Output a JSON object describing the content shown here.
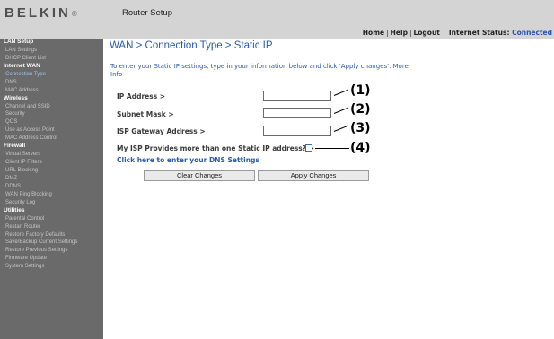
{
  "header": {
    "logo": "BELKIN",
    "logo_mark": "®",
    "title": "Router Setup",
    "nav": {
      "home": "Home",
      "help": "Help",
      "logout": "Logout",
      "separator": "|"
    },
    "status_label": "Internet Status:",
    "status_value": "Connected"
  },
  "sidebar": {
    "items": [
      {
        "label": "LAN Setup",
        "type": "header"
      },
      {
        "label": "LAN Settings",
        "type": "item"
      },
      {
        "label": "DHCP Client List",
        "type": "item"
      },
      {
        "label": "Internet WAN",
        "type": "header"
      },
      {
        "label": "Connection Type",
        "type": "active"
      },
      {
        "label": "DNS",
        "type": "item"
      },
      {
        "label": "MAC Address",
        "type": "item"
      },
      {
        "label": "Wireless",
        "type": "header"
      },
      {
        "label": "Channel and SSID",
        "type": "item"
      },
      {
        "label": "Security",
        "type": "item"
      },
      {
        "label": "QOS",
        "type": "item"
      },
      {
        "label": "Use as Access Point",
        "type": "item"
      },
      {
        "label": "MAC Address Control",
        "type": "item"
      },
      {
        "label": "Firewall",
        "type": "header"
      },
      {
        "label": "Virtual Servers",
        "type": "item"
      },
      {
        "label": "Client IP Filters",
        "type": "item"
      },
      {
        "label": "URL Blocking",
        "type": "item"
      },
      {
        "label": "DMZ",
        "type": "item"
      },
      {
        "label": "DDNS",
        "type": "item"
      },
      {
        "label": "WAN Ping Blocking",
        "type": "item"
      },
      {
        "label": "Security Log",
        "type": "item"
      },
      {
        "label": "Utilities",
        "type": "header"
      },
      {
        "label": "Parental Control",
        "type": "item"
      },
      {
        "label": "Restart Router",
        "type": "item"
      },
      {
        "label": "Restore Factory Defaults",
        "type": "item"
      },
      {
        "label": "Save/Backup Current Settings",
        "type": "item"
      },
      {
        "label": "Restore Previous Settings",
        "type": "item"
      },
      {
        "label": "Firmware Update",
        "type": "item"
      },
      {
        "label": "System Settings",
        "type": "item"
      }
    ]
  },
  "main": {
    "title": "WAN > Connection Type > Static IP",
    "intro": "To enter your Static IP settings, type in your information below and click 'Apply changes'. More Info",
    "fields": {
      "ip_address": {
        "label": "IP Address >",
        "value": ""
      },
      "subnet_mask": {
        "label": "Subnet Mask >",
        "value": ""
      },
      "gateway": {
        "label": "ISP Gateway Address >",
        "value": ""
      }
    },
    "multi_ip_label": "My ISP Provides more than one Static IP address? >",
    "multi_ip_checked": false,
    "dns_link": "Click here to enter your DNS Settings",
    "clear_button": "Clear Changes",
    "apply_button": "Apply Changes"
  },
  "callouts": [
    "(1)",
    "(2)",
    "(3)",
    "(4)"
  ],
  "colors": {
    "header_bg": "#d4d4d4",
    "sidebar_bg": "#6a6a6a",
    "sidebar_active": "#9fc0ea",
    "accent_blue": "#2b5aa8"
  }
}
